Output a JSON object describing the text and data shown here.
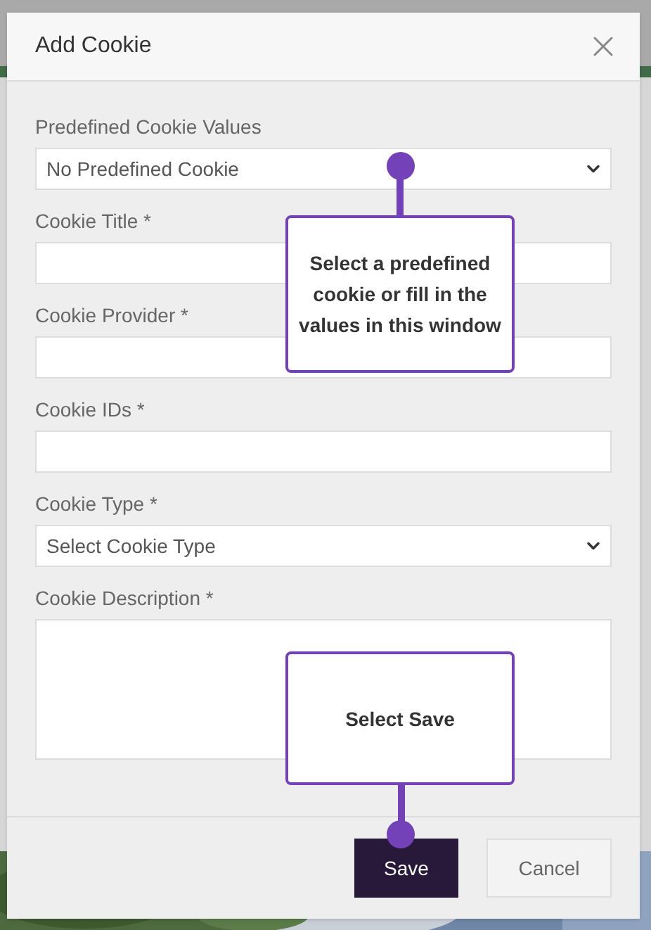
{
  "dialog": {
    "title": "Add Cookie",
    "fields": [
      {
        "kind": "select",
        "label": "Predefined Cookie Values",
        "value": "No Predefined Cookie"
      },
      {
        "kind": "text",
        "label": "Cookie Title *"
      },
      {
        "kind": "text",
        "label": "Cookie Provider *"
      },
      {
        "kind": "text",
        "label": "Cookie IDs *"
      },
      {
        "kind": "select",
        "label": "Cookie Type *",
        "value": "Select Cookie Type"
      },
      {
        "kind": "textarea",
        "label": "Cookie Description *"
      }
    ],
    "buttons": [
      {
        "label": "Save",
        "kind": "primary"
      },
      {
        "label": "Cancel",
        "kind": "secondary"
      }
    ]
  },
  "callouts": [
    {
      "text": "Select a predefined cookie or fill in the values in this window",
      "kind": "up"
    },
    {
      "text": "Select Save",
      "kind": "down"
    }
  ]
}
